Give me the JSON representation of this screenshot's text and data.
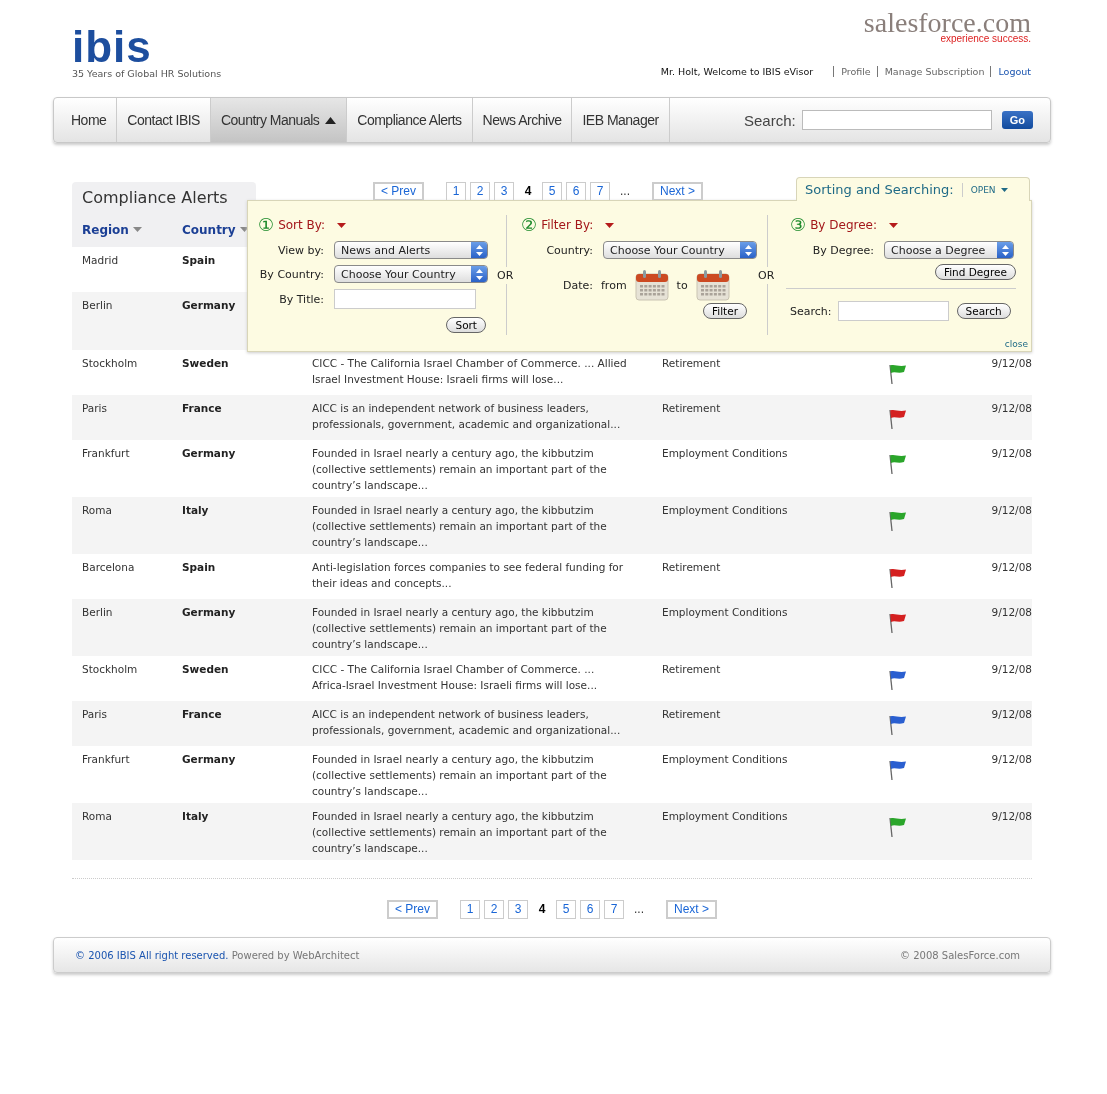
{
  "header": {
    "logo": {
      "text": "ibis",
      "tagline": "35 Years of Global HR Solutions"
    },
    "partner_logo": {
      "text": "salesforce.com",
      "slogan": "experience success."
    },
    "welcome": "Mr. Holt, Welcome to IBIS eVisor",
    "links": [
      "Profile",
      "Manage Subscription",
      "Logout"
    ]
  },
  "nav": {
    "items": [
      {
        "label": "Home",
        "selected": false,
        "caret": false
      },
      {
        "label": "Contact IBIS",
        "selected": false,
        "caret": false
      },
      {
        "label": "Country Manuals",
        "selected": true,
        "caret": true
      },
      {
        "label": "Compliance Alerts",
        "selected": false,
        "caret": false
      },
      {
        "label": "News Archive",
        "selected": false,
        "caret": false
      },
      {
        "label": "IEB Manager",
        "selected": false,
        "caret": false
      }
    ],
    "search_label": "Search:",
    "search_button": "Go"
  },
  "section_title": "Compliance Alerts",
  "pagination_top": {
    "prev": "< Prev",
    "pages": [
      {
        "label": "1",
        "selected": false
      },
      {
        "label": "2",
        "selected": false
      },
      {
        "label": "3",
        "selected": false
      },
      {
        "label": "4",
        "selected": true
      },
      {
        "label": "5",
        "selected": false
      },
      {
        "label": "6",
        "selected": false
      },
      {
        "label": "7",
        "selected": false
      }
    ],
    "ellipsis": "...",
    "next": "Next >"
  },
  "table": {
    "columns": [
      "Region",
      "Country"
    ],
    "rows": [
      {
        "region": "Madrid",
        "country": "Spain"
      },
      {
        "region": "Berlin",
        "country": "Germany"
      },
      {
        "region": "Stockholm",
        "country": "Sweden",
        "summary": "CICC - The California Israel Chamber of Commerce. ... Allied Israel Investment House: Israeli firms will lose...",
        "category": "Retirement",
        "color": "#2aa52a",
        "date": "9/12/08"
      },
      {
        "region": "Paris",
        "country": "France",
        "summary": "AICC is an independent network of business leaders, professionals, government, academic and organizational...",
        "category": "Retirement",
        "color": "#d42020",
        "date": "9/12/08"
      },
      {
        "region": "Frankfurt",
        "country": "Germany",
        "summary": "Founded in Israel nearly a century ago, the kibbutzim (collective settlements) remain an important part of the country’s landscape...",
        "category": "Employment Conditions",
        "color": "#2aa52a",
        "date": "9/12/08"
      },
      {
        "region": "Roma",
        "country": "Italy",
        "summary": "Founded in Israel nearly a century ago, the kibbutzim (collective settlements) remain an important part of the country’s landscape...",
        "category": "Employment Conditions",
        "color": "#2aa52a",
        "date": "9/12/08"
      },
      {
        "region": "Barcelona",
        "country": "Spain",
        "summary": "Anti-legislation forces companies to see federal funding for their ideas and concepts...",
        "category": "Retirement",
        "color": "#d42020",
        "date": "9/12/08"
      },
      {
        "region": "Berlin",
        "country": "Germany",
        "summary": "Founded in Israel nearly a century ago, the kibbutzim (collective settlements) remain an important part of the country’s landscape...",
        "category": "Employment Conditions",
        "color": "#d42020",
        "date": "9/12/08"
      },
      {
        "region": "Stockholm",
        "country": "Sweden",
        "summary": "CICC - The California Israel Chamber of Commerce. ... Africa-Israel Investment House: Israeli firms will lose...",
        "category": "Retirement",
        "color": "#2a5fd0",
        "date": "9/12/08"
      },
      {
        "region": "Paris",
        "country": "France",
        "summary": "AICC is an independent network of business leaders, professionals, government, academic and organizational...",
        "category": "Retirement",
        "color": "#2a5fd0",
        "date": "9/12/08"
      },
      {
        "region": "Frankfurt",
        "country": "Germany",
        "summary": "Founded in Israel nearly a century ago, the kibbutzim (collective settlements) remain an important part of the country’s landscape...",
        "category": "Employment Conditions",
        "color": "#2a5fd0",
        "date": "9/12/08"
      },
      {
        "region": "Roma",
        "country": "Italy",
        "summary": "Founded in Israel nearly a century ago, the kibbutzim (collective settlements) remain an important part of the country’s landscape...",
        "category": "Employment Conditions",
        "color": "#2aa52a",
        "date": "9/12/08"
      }
    ]
  },
  "panel": {
    "tab_title": "Sorting and Searching:",
    "toggle": "OPEN",
    "close": "close",
    "or": [
      "OR",
      "OR"
    ],
    "sort": {
      "number": "①",
      "title": "Sort By:",
      "view_label": "View by:",
      "view_value": "News and Alerts",
      "country_label": "By Country:",
      "country_value": "Choose Your Country",
      "title_label": "By Title:",
      "button": "Sort"
    },
    "filter": {
      "number": "②",
      "title": "Filter By:",
      "country_label": "Country:",
      "country_value": "Choose Your Country",
      "date_label": "Date:",
      "from": "from",
      "to": "to",
      "button": "Filter"
    },
    "degree": {
      "number": "③",
      "title": "By Degree:",
      "degree_label": "By Degree:",
      "degree_value": "Choose a Degree",
      "button": "Find Degree",
      "search_label": "Search:",
      "search_button": "Search"
    }
  },
  "pagination_bottom": {
    "prev": "< Prev",
    "pages": [
      {
        "label": "1",
        "selected": false
      },
      {
        "label": "2",
        "selected": false
      },
      {
        "label": "3",
        "selected": false
      },
      {
        "label": "4",
        "selected": true
      },
      {
        "label": "5",
        "selected": false
      },
      {
        "label": "6",
        "selected": false
      },
      {
        "label": "7",
        "selected": false
      }
    ],
    "ellipsis": "...",
    "next": "Next >"
  },
  "footer": {
    "copyright": "© 2006 IBIS All right reserved.",
    "powered": "Powered by WebArchitect",
    "right": "© 2008 SalesForce.com"
  }
}
